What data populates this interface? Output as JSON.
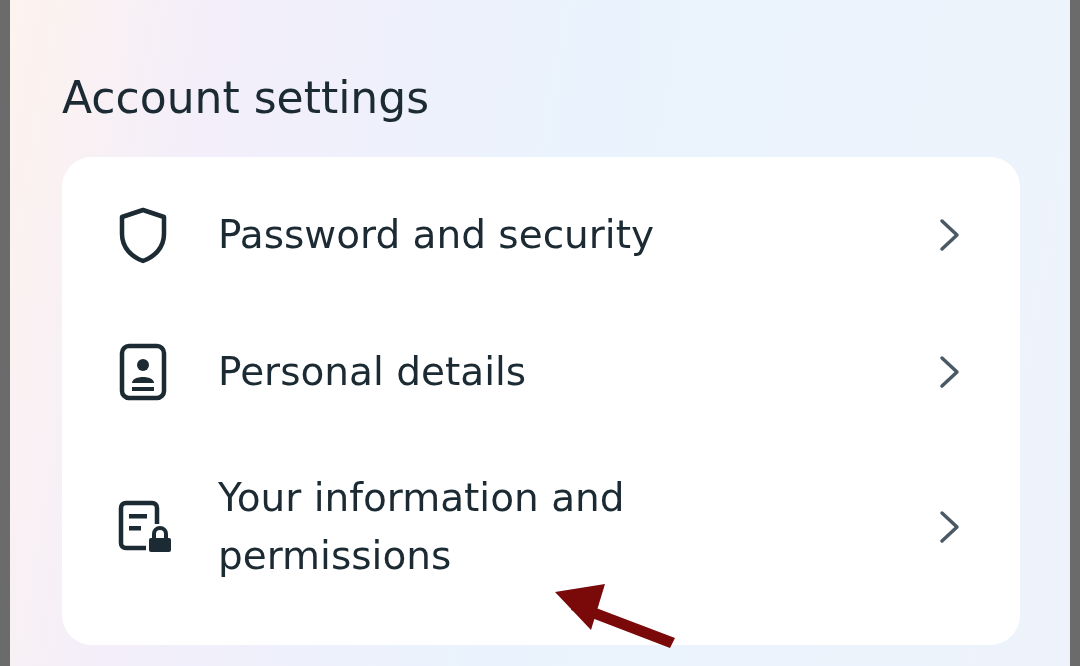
{
  "title": "Account settings",
  "items": [
    {
      "label": "Password and security"
    },
    {
      "label": "Personal details"
    },
    {
      "label": "Your information and permissions"
    }
  ]
}
